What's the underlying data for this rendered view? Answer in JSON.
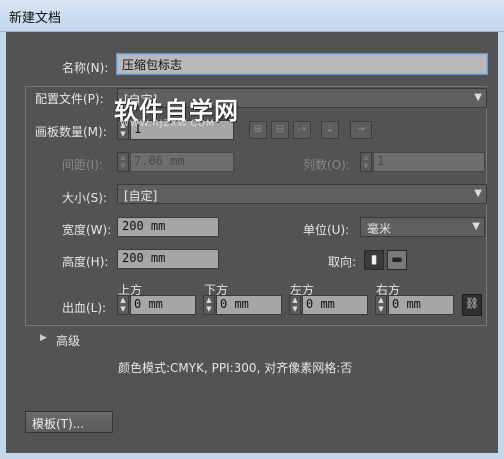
{
  "window": {
    "title": "新建文档"
  },
  "name": {
    "label": "名称(N):",
    "value": "压缩包标志"
  },
  "profile": {
    "label": "配置文件(P):",
    "value": "[自定]"
  },
  "artboards": {
    "count_label": "画板数量(M):",
    "count_value": "1",
    "spacing_label": "间距(I):",
    "spacing_value": "7.06 mm",
    "columns_label": "列数(O):",
    "columns_value": "1",
    "arrow_glyph": "→"
  },
  "size": {
    "label": "大小(S):",
    "value": "[自定]"
  },
  "width": {
    "label": "宽度(W):",
    "value": "200 mm"
  },
  "height": {
    "label": "高度(H):",
    "value": "200 mm"
  },
  "units": {
    "label": "单位(U):",
    "value": "毫米"
  },
  "orientation": {
    "label": "取向:",
    "selected": "portrait"
  },
  "bleed": {
    "label": "出血(L):",
    "top_label": "上方",
    "top_value": "0 mm",
    "bottom_label": "下方",
    "bottom_value": "0 mm",
    "left_label": "左方",
    "left_value": "0 mm",
    "right_label": "右方",
    "right_value": "0 mm"
  },
  "advanced": {
    "label": "高级",
    "info": "颜色模式:CMYK, PPI:300, 对齐像素网格:否"
  },
  "templates_button": "模板(T)...",
  "watermark": {
    "text": "软件自学网",
    "url": "WWW.RJZXW.COM"
  },
  "colors": {
    "panel_bg": "#535353",
    "field_bg": "#a6a6a6",
    "title_bar": "#c3d6ec"
  }
}
